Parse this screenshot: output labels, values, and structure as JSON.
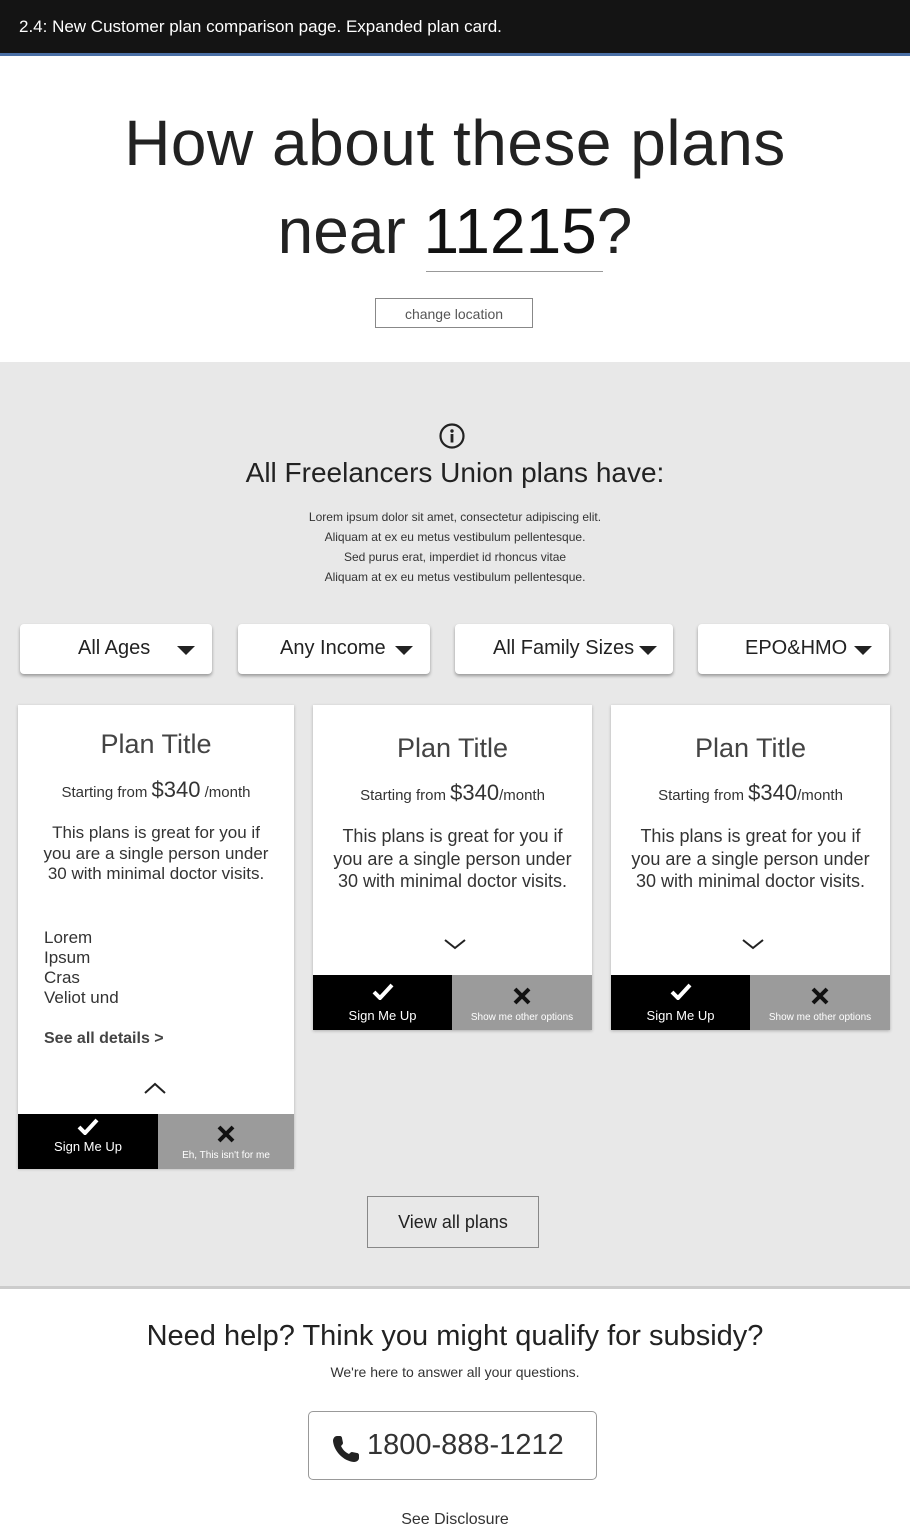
{
  "header": {
    "caption": "2.4: New Customer plan comparison page. Expanded plan card."
  },
  "hero": {
    "line1": "How about these plans",
    "line2_prefix": "near ",
    "zip": "11215",
    "line2_suffix": "?",
    "change_location_label": "change location"
  },
  "benefits": {
    "icon": "info-icon",
    "title": "All Freelancers Union plans have:",
    "lines": [
      "Lorem ipsum dolor sit amet, consectetur adipiscing elit.",
      "Aliquam at ex eu metus vestibulum pellentesque.",
      "Sed purus erat, imperdiet id rhoncus vitae",
      "Aliquam at ex eu metus vestibulum pellentesque."
    ]
  },
  "filters": [
    {
      "label": "All Ages"
    },
    {
      "label": "Any Income"
    },
    {
      "label": "All Family Sizes"
    },
    {
      "label": "EPO&HMO"
    }
  ],
  "plans": [
    {
      "title": "Plan Title",
      "price_prefix": "Starting from ",
      "price": "$340",
      "price_suffix": " /month",
      "description": "This plans is great for you if you are a single person under 30 with minimal doctor visits.",
      "features": [
        "Lorem",
        "Ipsum",
        "Cras",
        "Veliot und"
      ],
      "details_link": "See all details >",
      "sign_up_label": "Sign Me Up",
      "decline_label": "Eh, This isn't for me",
      "expanded": true
    },
    {
      "title": "Plan Title",
      "price_prefix": "Starting from ",
      "price": "$340",
      "price_suffix": "/month",
      "description": "This plans is great for you if you are a single person under 30 with minimal doctor visits.",
      "sign_up_label": "Sign Me Up",
      "decline_label": "Show me other options",
      "expanded": false
    },
    {
      "title": "Plan Title",
      "price_prefix": "Starting from ",
      "price": "$340",
      "price_suffix": "/month",
      "description": "This plans is great for you if you are a single person under 30 with minimal doctor visits.",
      "sign_up_label": "Sign Me Up",
      "decline_label": "Show me other options",
      "expanded": false
    }
  ],
  "view_all_label": "View all plans",
  "help": {
    "title": "Need help? Think you might qualify for subsidy?",
    "subtitle": "We're here to answer all your questions.",
    "phone": "1800-888-1212",
    "phone_icon": "phone-icon"
  },
  "disclosure_label": "See Disclosure",
  "colors": {
    "topbar": "#141414",
    "accent_line": "#4a6fa5",
    "section_bg": "#e8e8e8",
    "sign_up_bg": "#000000",
    "decline_bg": "#9b9b9b"
  }
}
